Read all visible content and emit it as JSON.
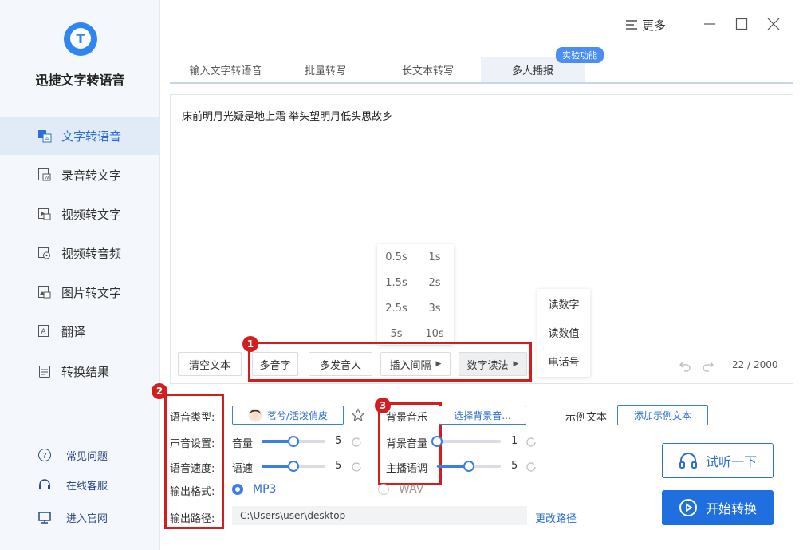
{
  "app": {
    "title": "迅捷文字转语音",
    "logo_letter": "T"
  },
  "sidebar": {
    "items": [
      {
        "label": "文字转语音",
        "icon": "text-to-speech-icon"
      },
      {
        "label": "录音转文字",
        "icon": "recording-to-text-icon"
      },
      {
        "label": "视频转文字",
        "icon": "video-to-text-icon"
      },
      {
        "label": "视频转音频",
        "icon": "video-to-audio-icon"
      },
      {
        "label": "图片转文字",
        "icon": "image-to-text-icon"
      },
      {
        "label": "翻译",
        "icon": "translate-icon"
      },
      {
        "label": "转换结果",
        "icon": "results-icon"
      }
    ],
    "footer": [
      {
        "label": "常见问题",
        "icon": "question-icon"
      },
      {
        "label": "在线客服",
        "icon": "headset-icon"
      },
      {
        "label": "进入官网",
        "icon": "monitor-icon"
      }
    ]
  },
  "topbar": {
    "more_label": "更多"
  },
  "tabs": [
    {
      "label": "输入文字转语音"
    },
    {
      "label": "批量转写"
    },
    {
      "label": "长文本转写"
    },
    {
      "label": "多人播报"
    }
  ],
  "experimental_badge": "实验功能",
  "editor": {
    "text": "床前明月光疑是地上霜 举头望明月低头思故乡",
    "counter": "22 / 2000"
  },
  "interval_menu": {
    "options": [
      "0.5s",
      "1s",
      "1.5s",
      "2s",
      "2.5s",
      "3s",
      "5s",
      "10s"
    ]
  },
  "digit_menu": {
    "options": [
      "读数字",
      "读数值",
      "电话号"
    ]
  },
  "toolbar": {
    "clear": "清空文本",
    "polyphone": "多音字",
    "multi_speaker": "多发音人",
    "insert_interval": "插入间隔",
    "digit_reading": "数字读法"
  },
  "annotations": [
    "1",
    "2",
    "3"
  ],
  "settings": {
    "voice_type_label": "语音类型:",
    "voice_name": "茗兮/活泼俏皮",
    "sound_label": "声音设置:",
    "volume_label": "音量",
    "volume_value": "5",
    "volume_level": 0.5,
    "speed_label": "语音速度:",
    "speed_name": "语速",
    "speed_value": "5",
    "speed_level": 0.5,
    "format_label": "输出格式:",
    "format_mp3": "MP3",
    "format_wav": "WAV",
    "selected_format": "MP3",
    "path_label": "输出路径:",
    "path_value": "C:\\Users\\user\\desktop",
    "change_path": "更改路径",
    "bgm_label": "背景音乐",
    "choose_bgm": "选择背景音...",
    "bgm_volume_label": "背景音量",
    "bgm_volume_value": "1",
    "bgm_volume_level": 0.0,
    "main_tone_label": "主播语调",
    "main_tone_value": "5",
    "main_tone_level": 0.5,
    "sample_text_label": "示例文本",
    "add_sample_text": "添加示例文本"
  },
  "actions": {
    "listen": "试听一下",
    "convert": "开始转换"
  },
  "colors": {
    "accent": "#1f6fe0",
    "annotation_red": "#d21e1e",
    "sidebar_bg": "#f4f7fb",
    "active_nav_bg": "#e1ebf8"
  }
}
